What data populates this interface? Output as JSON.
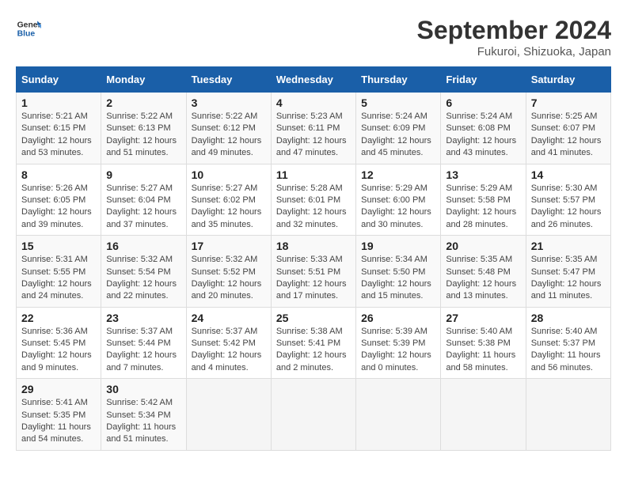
{
  "header": {
    "logo_general": "General",
    "logo_blue": "Blue",
    "month": "September 2024",
    "location": "Fukuroi, Shizuoka, Japan"
  },
  "weekdays": [
    "Sunday",
    "Monday",
    "Tuesday",
    "Wednesday",
    "Thursday",
    "Friday",
    "Saturday"
  ],
  "weeks": [
    [
      {
        "day": "1",
        "info": "Sunrise: 5:21 AM\nSunset: 6:15 PM\nDaylight: 12 hours\nand 53 minutes."
      },
      {
        "day": "2",
        "info": "Sunrise: 5:22 AM\nSunset: 6:13 PM\nDaylight: 12 hours\nand 51 minutes."
      },
      {
        "day": "3",
        "info": "Sunrise: 5:22 AM\nSunset: 6:12 PM\nDaylight: 12 hours\nand 49 minutes."
      },
      {
        "day": "4",
        "info": "Sunrise: 5:23 AM\nSunset: 6:11 PM\nDaylight: 12 hours\nand 47 minutes."
      },
      {
        "day": "5",
        "info": "Sunrise: 5:24 AM\nSunset: 6:09 PM\nDaylight: 12 hours\nand 45 minutes."
      },
      {
        "day": "6",
        "info": "Sunrise: 5:24 AM\nSunset: 6:08 PM\nDaylight: 12 hours\nand 43 minutes."
      },
      {
        "day": "7",
        "info": "Sunrise: 5:25 AM\nSunset: 6:07 PM\nDaylight: 12 hours\nand 41 minutes."
      }
    ],
    [
      {
        "day": "8",
        "info": "Sunrise: 5:26 AM\nSunset: 6:05 PM\nDaylight: 12 hours\nand 39 minutes."
      },
      {
        "day": "9",
        "info": "Sunrise: 5:27 AM\nSunset: 6:04 PM\nDaylight: 12 hours\nand 37 minutes."
      },
      {
        "day": "10",
        "info": "Sunrise: 5:27 AM\nSunset: 6:02 PM\nDaylight: 12 hours\nand 35 minutes."
      },
      {
        "day": "11",
        "info": "Sunrise: 5:28 AM\nSunset: 6:01 PM\nDaylight: 12 hours\nand 32 minutes."
      },
      {
        "day": "12",
        "info": "Sunrise: 5:29 AM\nSunset: 6:00 PM\nDaylight: 12 hours\nand 30 minutes."
      },
      {
        "day": "13",
        "info": "Sunrise: 5:29 AM\nSunset: 5:58 PM\nDaylight: 12 hours\nand 28 minutes."
      },
      {
        "day": "14",
        "info": "Sunrise: 5:30 AM\nSunset: 5:57 PM\nDaylight: 12 hours\nand 26 minutes."
      }
    ],
    [
      {
        "day": "15",
        "info": "Sunrise: 5:31 AM\nSunset: 5:55 PM\nDaylight: 12 hours\nand 24 minutes."
      },
      {
        "day": "16",
        "info": "Sunrise: 5:32 AM\nSunset: 5:54 PM\nDaylight: 12 hours\nand 22 minutes."
      },
      {
        "day": "17",
        "info": "Sunrise: 5:32 AM\nSunset: 5:52 PM\nDaylight: 12 hours\nand 20 minutes."
      },
      {
        "day": "18",
        "info": "Sunrise: 5:33 AM\nSunset: 5:51 PM\nDaylight: 12 hours\nand 17 minutes."
      },
      {
        "day": "19",
        "info": "Sunrise: 5:34 AM\nSunset: 5:50 PM\nDaylight: 12 hours\nand 15 minutes."
      },
      {
        "day": "20",
        "info": "Sunrise: 5:35 AM\nSunset: 5:48 PM\nDaylight: 12 hours\nand 13 minutes."
      },
      {
        "day": "21",
        "info": "Sunrise: 5:35 AM\nSunset: 5:47 PM\nDaylight: 12 hours\nand 11 minutes."
      }
    ],
    [
      {
        "day": "22",
        "info": "Sunrise: 5:36 AM\nSunset: 5:45 PM\nDaylight: 12 hours\nand 9 minutes."
      },
      {
        "day": "23",
        "info": "Sunrise: 5:37 AM\nSunset: 5:44 PM\nDaylight: 12 hours\nand 7 minutes."
      },
      {
        "day": "24",
        "info": "Sunrise: 5:37 AM\nSunset: 5:42 PM\nDaylight: 12 hours\nand 4 minutes."
      },
      {
        "day": "25",
        "info": "Sunrise: 5:38 AM\nSunset: 5:41 PM\nDaylight: 12 hours\nand 2 minutes."
      },
      {
        "day": "26",
        "info": "Sunrise: 5:39 AM\nSunset: 5:39 PM\nDaylight: 12 hours\nand 0 minutes."
      },
      {
        "day": "27",
        "info": "Sunrise: 5:40 AM\nSunset: 5:38 PM\nDaylight: 11 hours\nand 58 minutes."
      },
      {
        "day": "28",
        "info": "Sunrise: 5:40 AM\nSunset: 5:37 PM\nDaylight: 11 hours\nand 56 minutes."
      }
    ],
    [
      {
        "day": "29",
        "info": "Sunrise: 5:41 AM\nSunset: 5:35 PM\nDaylight: 11 hours\nand 54 minutes."
      },
      {
        "day": "30",
        "info": "Sunrise: 5:42 AM\nSunset: 5:34 PM\nDaylight: 11 hours\nand 51 minutes."
      },
      {
        "day": "",
        "info": ""
      },
      {
        "day": "",
        "info": ""
      },
      {
        "day": "",
        "info": ""
      },
      {
        "day": "",
        "info": ""
      },
      {
        "day": "",
        "info": ""
      }
    ]
  ]
}
